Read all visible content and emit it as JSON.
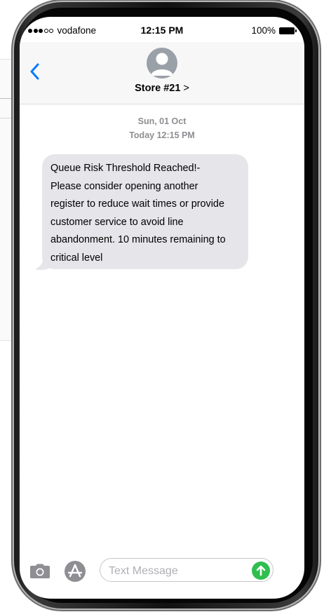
{
  "status_bar": {
    "signal_full": 3,
    "signal_total": 5,
    "carrier": "vodafone",
    "time": "12:15 PM",
    "battery": "100%"
  },
  "header": {
    "back_icon": "chevron-left-icon",
    "avatar_icon": "person-icon",
    "contact_name": "Store #21",
    "contact_chevron": ">"
  },
  "thread": {
    "date_line": "Sun, 01 Oct",
    "time_line": "Today 12:15 PM",
    "messages": [
      {
        "direction": "incoming",
        "lines": [
          "Queue Risk Threshold Reached!-",
          "Please consider opening another",
          "register to reduce wait times or provide",
          "customer service to avoid line",
          "abandonment. 10 minutes remaining to",
          "critical level"
        ]
      }
    ]
  },
  "composer": {
    "camera_icon": "camera-icon",
    "apps_icon": "app-store-icon",
    "placeholder": "Text Message",
    "value": "",
    "send_icon": "send-arrow-up-icon"
  },
  "colors": {
    "accent": "#007aff",
    "bubble_incoming": "#e5e5ea",
    "send": "#2fbe4f",
    "timestamp": "#8e8e93"
  }
}
